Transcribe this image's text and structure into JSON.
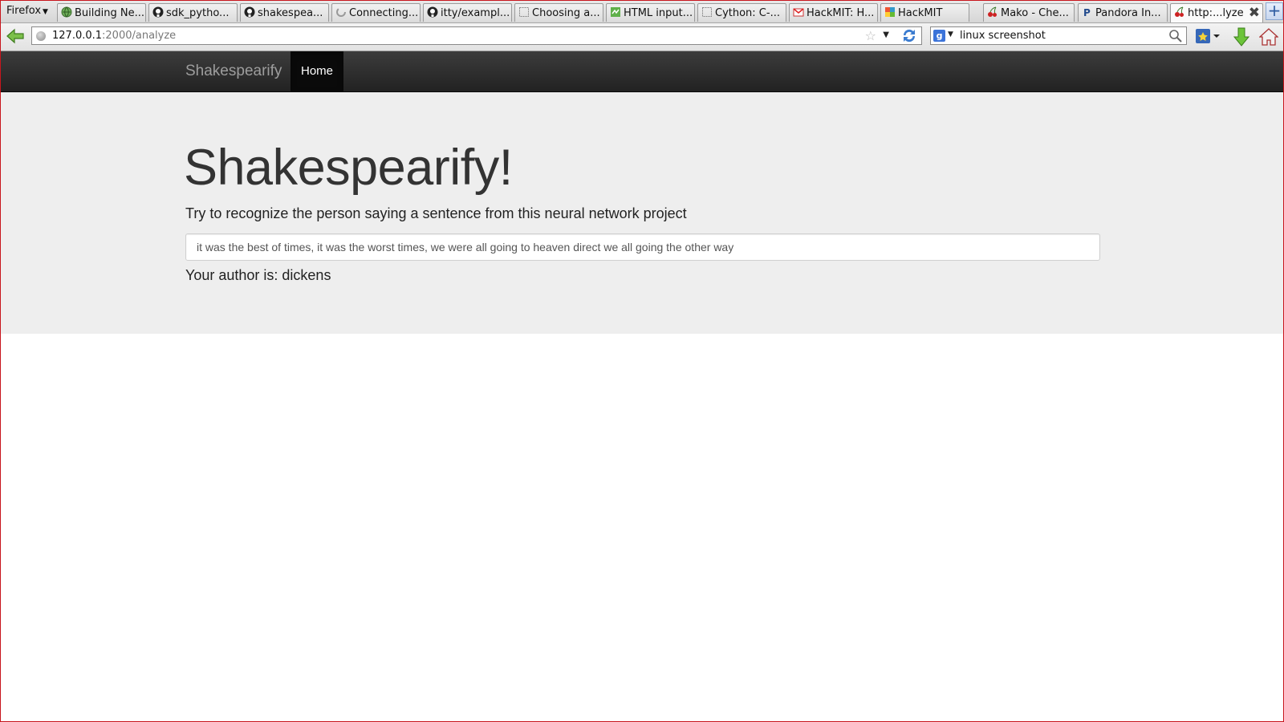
{
  "browser": {
    "menu_label": "Firefox",
    "tabs": [
      {
        "title": "Building Ne...",
        "icon": "globe-icon"
      },
      {
        "title": "sdk_pytho...",
        "icon": "github-icon"
      },
      {
        "title": "shakespea...",
        "icon": "github-icon"
      },
      {
        "title": "Connecting...",
        "icon": "loading-icon"
      },
      {
        "title": "itty/exampl...",
        "icon": "github-icon"
      },
      {
        "title": "Choosing a...",
        "icon": "blank-page-icon"
      },
      {
        "title": "HTML input...",
        "icon": "site-icon"
      },
      {
        "title": "Cython: C-...",
        "icon": "blank-page-icon"
      },
      {
        "title": "HackMIT: H...",
        "icon": "gmail-icon"
      },
      {
        "title": "HackMIT",
        "icon": "hackmit-icon"
      },
      {
        "title": "Mako - Che...",
        "icon": "cherry-icon"
      },
      {
        "title": "Pandora In...",
        "icon": "pandora-icon"
      },
      {
        "title": "http:...lyze",
        "icon": "cherry-icon",
        "active": true
      }
    ],
    "url": {
      "host": "127.0.0.1",
      "path": ":2000/analyze"
    },
    "search": {
      "engine": "g",
      "query": "linux screenshot"
    }
  },
  "site": {
    "brand": "Shakespearify",
    "nav": [
      {
        "label": "Home",
        "active": true
      }
    ]
  },
  "hero": {
    "title": "Shakespearify!",
    "lead": "Try to recognize the person saying a sentence from this neural network project",
    "input_value": "it was the best of times, it was the worst times, we were all going to heaven direct we all going the other way",
    "result": "Your author is: dickens"
  }
}
